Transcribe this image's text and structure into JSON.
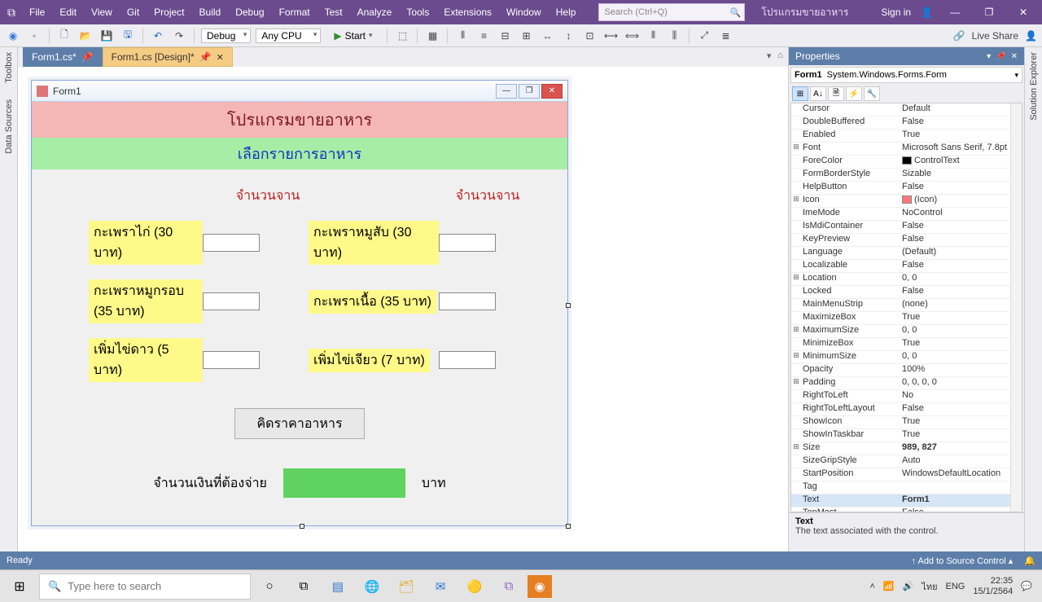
{
  "titlebar": {
    "menus": [
      "File",
      "Edit",
      "View",
      "Git",
      "Project",
      "Build",
      "Debug",
      "Format",
      "Test",
      "Analyze",
      "Tools",
      "Extensions",
      "Window",
      "Help"
    ],
    "search_placeholder": "Search (Ctrl+Q)",
    "solution": "โปรแกรมขายอาหาร",
    "signin": "Sign in",
    "min": "—",
    "max": "❐",
    "close": "✕"
  },
  "toolbar": {
    "config": "Debug",
    "platform": "Any CPU",
    "start": "Start",
    "liveshare": "Live Share"
  },
  "leftrail": {
    "toolbox": "Toolbox",
    "datasources": "Data Sources"
  },
  "rightrail": {
    "solution": "Solution Explorer"
  },
  "doctabs": {
    "tab1": "Form1.cs*",
    "tab2": "Form1.cs [Design]*"
  },
  "form": {
    "title": "Form1",
    "banner1": "โปรแกรมขายอาหาร",
    "banner2": "เลือกรายการอาหาร",
    "hdr1": "จำนวนจาน",
    "hdr2": "จำนวนจาน",
    "itemA": "กะเพราไก่ (30 บาท)",
    "itemB": "กะเพราหมูสับ (30 บาท)",
    "itemC": "กะเพราหมูกรอบ (35 บาท)",
    "itemD": "กะเพราเนื้อ  (35 บาท)",
    "itemE": "เพิ่มไข่ดาว (5 บาท)",
    "itemF": "เพิ่มไข่เจียว (7 บาท)",
    "calc": "คิดราคาอาหาร",
    "total_label": "จำนวนเงินที่ต้องจ่าย",
    "unit": "บาท"
  },
  "props": {
    "title": "Properties",
    "object_name": "Form1",
    "object_type": "System.Windows.Forms.Form",
    "rows": [
      {
        "e": "",
        "n": "Cursor",
        "v": "Default"
      },
      {
        "e": "",
        "n": "DoubleBuffered",
        "v": "False"
      },
      {
        "e": "",
        "n": "Enabled",
        "v": "True"
      },
      {
        "e": "⊞",
        "n": "Font",
        "v": "Microsoft Sans Serif, 7.8pt"
      },
      {
        "e": "",
        "n": "ForeColor",
        "v": "ControlText",
        "swatch": "color"
      },
      {
        "e": "",
        "n": "FormBorderStyle",
        "v": "Sizable"
      },
      {
        "e": "",
        "n": "HelpButton",
        "v": "False"
      },
      {
        "e": "⊞",
        "n": "Icon",
        "v": "(Icon)",
        "swatch": "icon"
      },
      {
        "e": "",
        "n": "ImeMode",
        "v": "NoControl"
      },
      {
        "e": "",
        "n": "IsMdiContainer",
        "v": "False"
      },
      {
        "e": "",
        "n": "KeyPreview",
        "v": "False"
      },
      {
        "e": "",
        "n": "Language",
        "v": "(Default)"
      },
      {
        "e": "",
        "n": "Localizable",
        "v": "False"
      },
      {
        "e": "⊞",
        "n": "Location",
        "v": "0, 0"
      },
      {
        "e": "",
        "n": "Locked",
        "v": "False"
      },
      {
        "e": "",
        "n": "MainMenuStrip",
        "v": "(none)"
      },
      {
        "e": "",
        "n": "MaximizeBox",
        "v": "True"
      },
      {
        "e": "⊞",
        "n": "MaximumSize",
        "v": "0, 0"
      },
      {
        "e": "",
        "n": "MinimizeBox",
        "v": "True"
      },
      {
        "e": "⊞",
        "n": "MinimumSize",
        "v": "0, 0"
      },
      {
        "e": "",
        "n": "Opacity",
        "v": "100%"
      },
      {
        "e": "⊞",
        "n": "Padding",
        "v": "0, 0, 0, 0"
      },
      {
        "e": "",
        "n": "RightToLeft",
        "v": "No"
      },
      {
        "e": "",
        "n": "RightToLeftLayout",
        "v": "False"
      },
      {
        "e": "",
        "n": "ShowIcon",
        "v": "True"
      },
      {
        "e": "",
        "n": "ShowInTaskbar",
        "v": "True"
      },
      {
        "e": "⊞",
        "n": "Size",
        "v": "989, 827",
        "bold": true
      },
      {
        "e": "",
        "n": "SizeGripStyle",
        "v": "Auto"
      },
      {
        "e": "",
        "n": "StartPosition",
        "v": "WindowsDefaultLocation"
      },
      {
        "e": "",
        "n": "Tag",
        "v": ""
      },
      {
        "e": "",
        "n": "Text",
        "v": "Form1",
        "bold": true,
        "sel": true
      },
      {
        "e": "",
        "n": "TopMost",
        "v": "False"
      }
    ],
    "desc_title": "Text",
    "desc_body": "The text associated with the control."
  },
  "status": {
    "ready": "Ready",
    "addsrc": "↑ Add to Source Control ▴"
  },
  "taskbar": {
    "search": "Type here to search",
    "lang1": "ไทย",
    "lang2": "ENG",
    "time": "22:35",
    "date": "15/1/2564"
  }
}
